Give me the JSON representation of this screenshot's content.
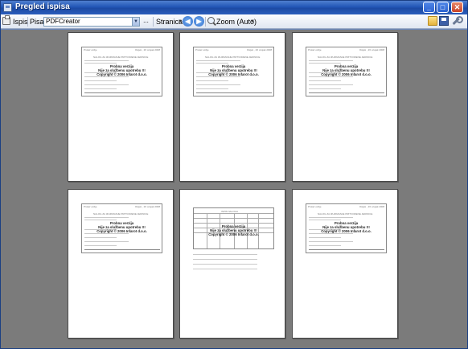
{
  "window": {
    "title": "Pregled ispisa"
  },
  "toolbar": {
    "print_label": "Ispis",
    "printer_label": "Pisač",
    "printer_value": "PDFCreator",
    "browse_label": "...",
    "page_label": "Stranica",
    "zoom_label": "Zoom (Auto)"
  },
  "pages": [
    {
      "header_left": "Prolaz ozdje",
      "header_right": "Osijek , 26 ozujak 2008",
      "title": "NALOG ZA IZUZIMANJE PRITVORENE JEDINICE",
      "watermark": [
        "Probna verzija",
        "Nije za službenu upotrebu !!!",
        "Copyright ©  2006 Infarot d.o.o."
      ]
    },
    {
      "header_left": "Prolaz ozdje",
      "header_right": "Osijek , 26 ozujak 2008",
      "title": "NALOG ZA IZUZIMANJE PRITVORENE JEDINICE",
      "watermark": [
        "Probna verzija",
        "Nije za službenu upotrebu !!!",
        "Copyright ©  2006 Infarot d.o.o."
      ]
    },
    {
      "header_left": "Prolaz ozdje",
      "header_right": "Osijek , 26 ozujak 2008",
      "title": "NALOG ZA IZUZIMANJE PRITVORENE JEDINICE",
      "watermark": [
        "Probna verzija",
        "Nije za službenu upotrebu !!!",
        "Copyright ©  2006 Infarot d.o.o."
      ]
    },
    {
      "header_left": "Prolaz ozdje",
      "header_right": "Osijek , 26 ozujak 2008",
      "title": "NALOG ZA IZUZIMANJE PRITVORENE JEDINICE",
      "watermark": [
        "Probna verzija",
        "Nije za službenu upotrebu !!!",
        "Copyright ©  2006 Infarot d.o.o."
      ]
    },
    {
      "header_left": "",
      "header_right": "",
      "title": "ISPIS NALOGA",
      "watermark": [
        "Probna verzija",
        "Nije za službenu upotrebu !!!",
        "Copyright ©  2006 Infarot d.o.o."
      ]
    },
    {
      "header_left": "Prolaz ozdje",
      "header_right": "Osijek , 26 ozujak 2008",
      "title": "NALOG ZA IZUZIMANJE PRITVORENE JEDINICE",
      "watermark": [
        "Probna verzija",
        "Nije za službenu upotrebu !!!",
        "Copyright ©  2006 Infarot d.o.o."
      ]
    }
  ]
}
